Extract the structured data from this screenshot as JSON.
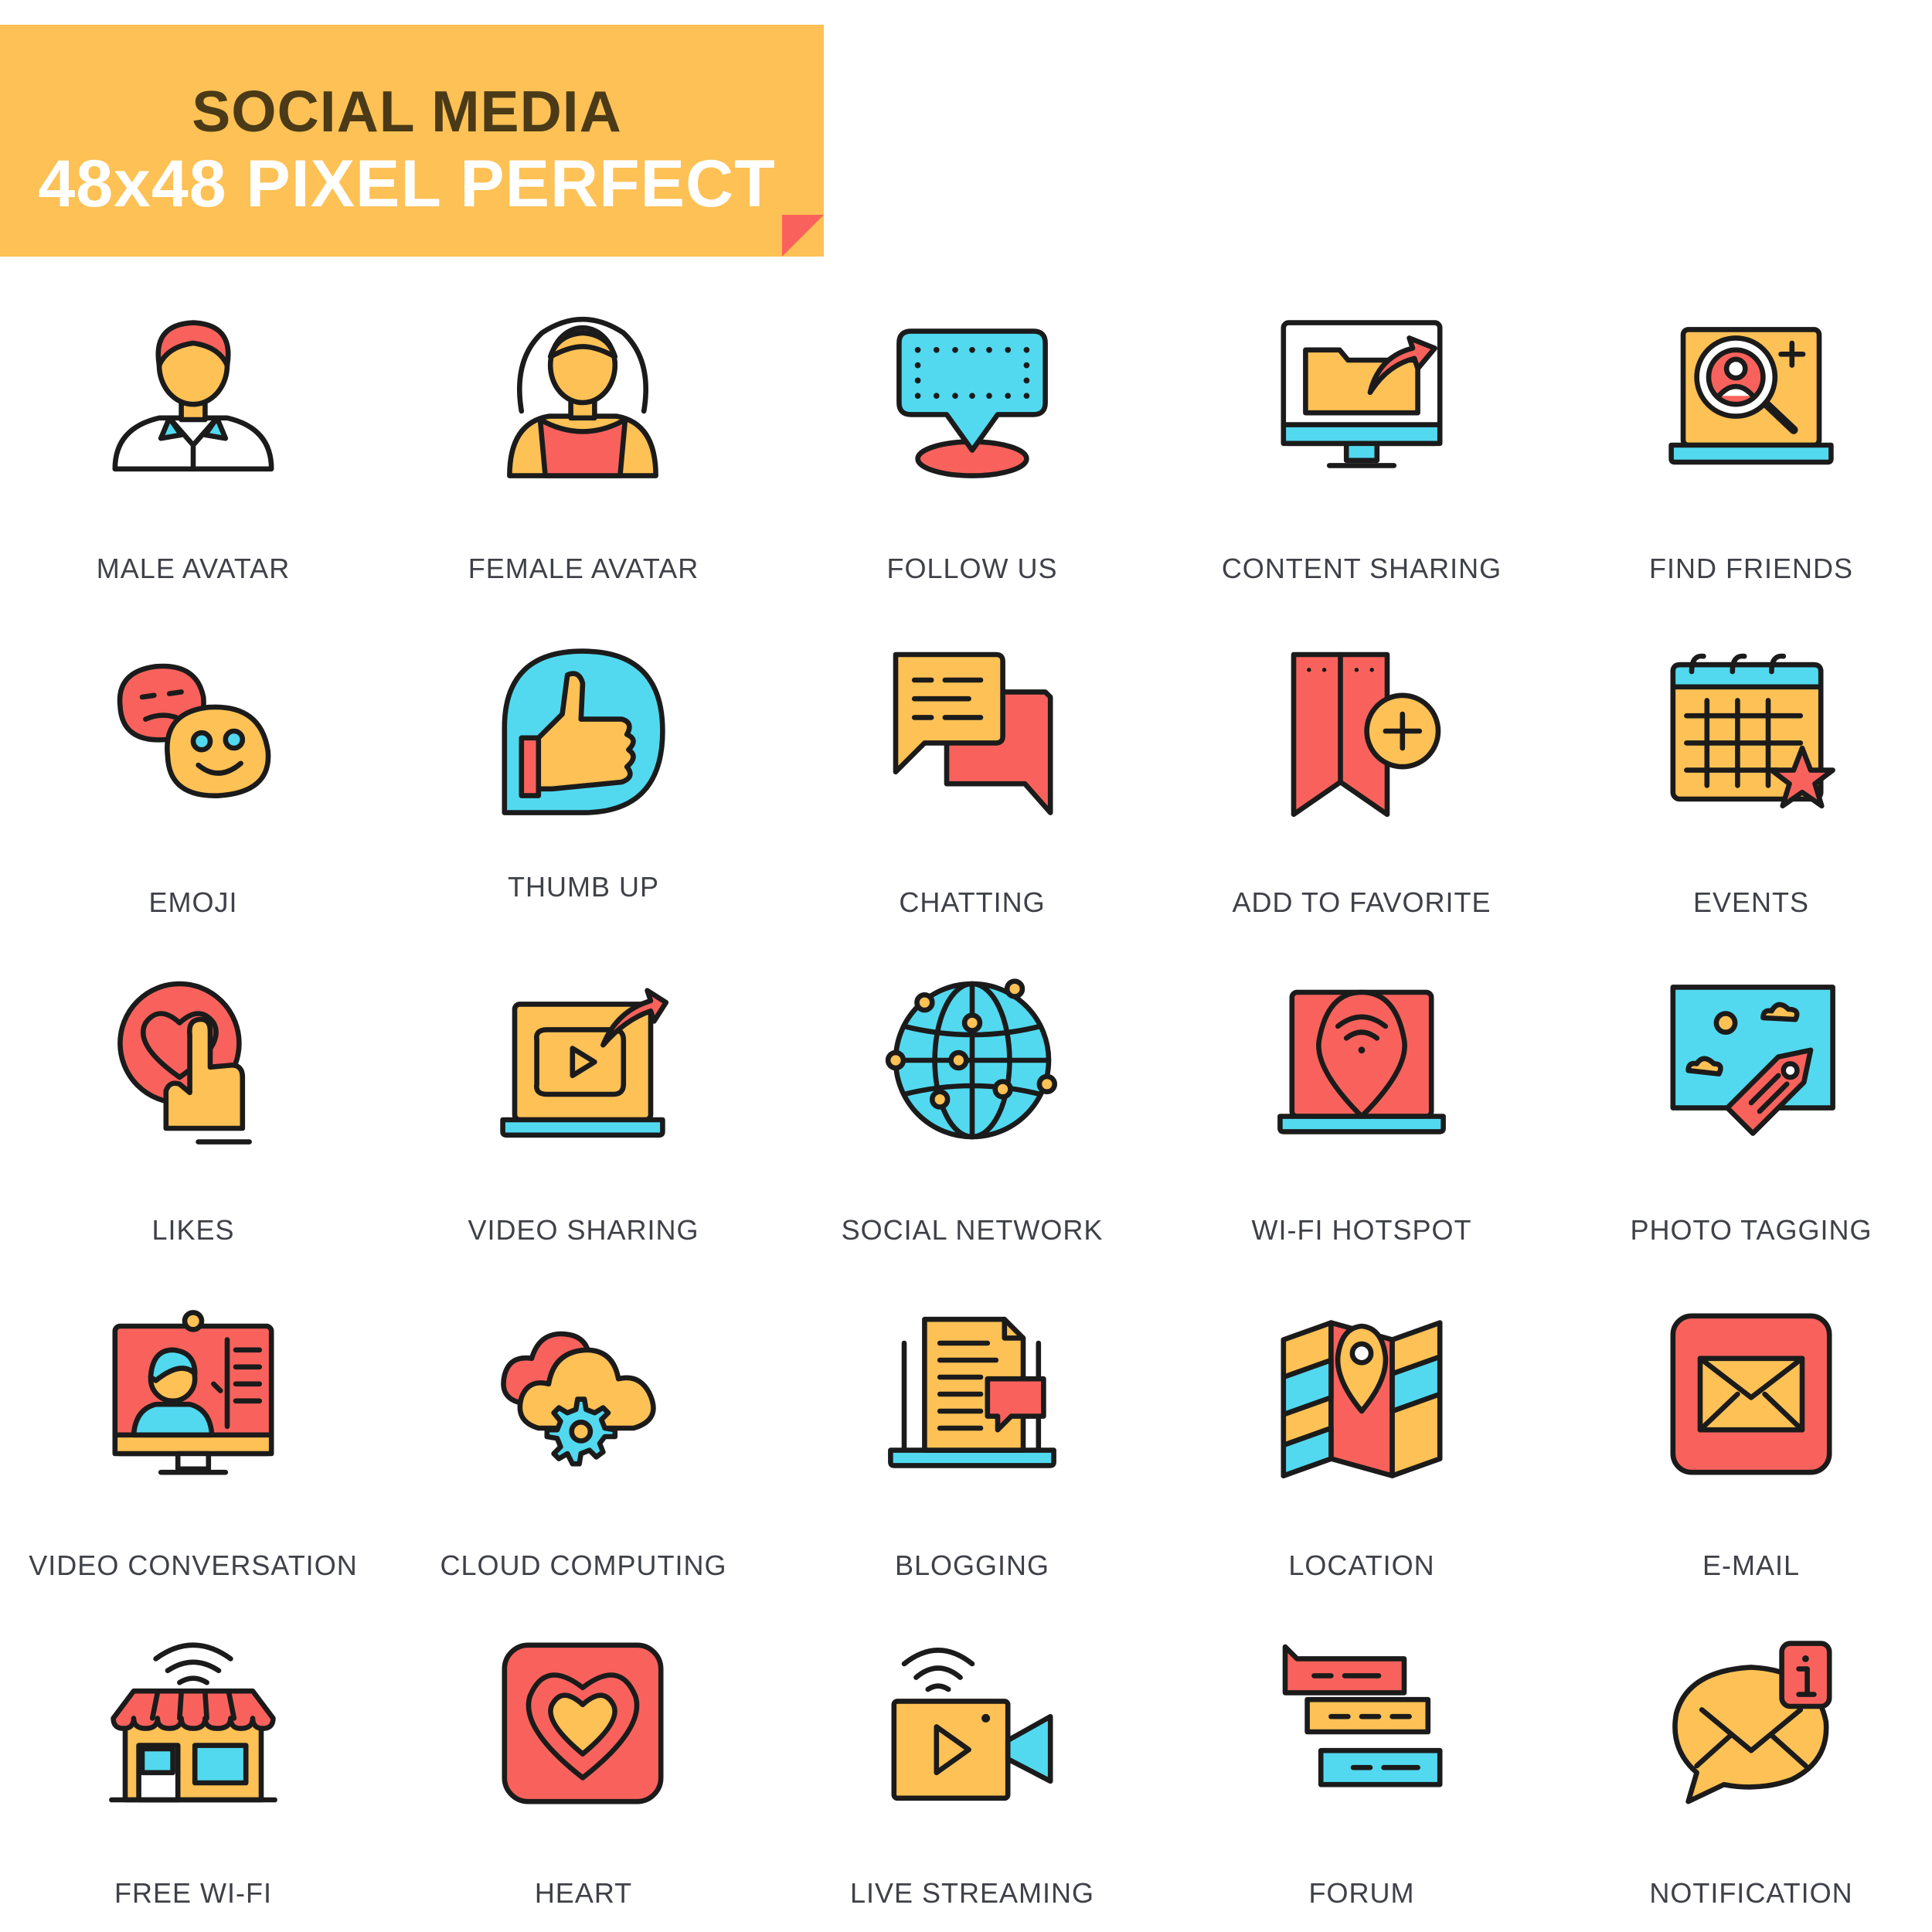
{
  "header": {
    "line1": "SOCIAL MEDIA",
    "line2": "48x48 PIXEL PERFECT"
  },
  "colors": {
    "yellow": "#FDC155",
    "red": "#F9625C",
    "cyan": "#52D9EF",
    "outline": "#1B1B1B",
    "banner": "#FDC155",
    "title_dark": "#4a3a17"
  },
  "icons": [
    {
      "label": "MALE AVATAR",
      "icon": "male-avatar-icon"
    },
    {
      "label": "FEMALE AVATAR",
      "icon": "female-avatar-icon"
    },
    {
      "label": "FOLLOW US",
      "icon": "follow-us-icon"
    },
    {
      "label": "CONTENT SHARING",
      "icon": "content-sharing-icon"
    },
    {
      "label": "FIND FRIENDS",
      "icon": "find-friends-icon"
    },
    {
      "label": "EMOJI",
      "icon": "emoji-icon"
    },
    {
      "label": "THUMB UP",
      "icon": "thumb-up-icon"
    },
    {
      "label": "CHATTING",
      "icon": "chatting-icon"
    },
    {
      "label": "ADD TO FAVORITE",
      "icon": "add-to-favorite-icon"
    },
    {
      "label": "EVENTS",
      "icon": "events-icon"
    },
    {
      "label": "LIKES",
      "icon": "likes-icon"
    },
    {
      "label": "VIDEO SHARING",
      "icon": "video-sharing-icon"
    },
    {
      "label": "SOCIAL NETWORK",
      "icon": "social-network-icon"
    },
    {
      "label": "WI-FI HOTSPOT",
      "icon": "wifi-hotspot-icon"
    },
    {
      "label": "PHOTO TAGGING",
      "icon": "photo-tagging-icon"
    },
    {
      "label": "VIDEO CONVERSATION",
      "icon": "video-conversation-icon"
    },
    {
      "label": "CLOUD COMPUTING",
      "icon": "cloud-computing-icon"
    },
    {
      "label": "BLOGGING",
      "icon": "blogging-icon"
    },
    {
      "label": "LOCATION",
      "icon": "location-icon"
    },
    {
      "label": "E-MAIL",
      "icon": "email-icon"
    },
    {
      "label": "FREE WI-FI",
      "icon": "free-wifi-icon"
    },
    {
      "label": "HEART",
      "icon": "heart-icon"
    },
    {
      "label": "LIVE STREAMING",
      "icon": "live-streaming-icon"
    },
    {
      "label": "FORUM",
      "icon": "forum-icon"
    },
    {
      "label": "NOTIFICATION",
      "icon": "notification-icon"
    }
  ]
}
